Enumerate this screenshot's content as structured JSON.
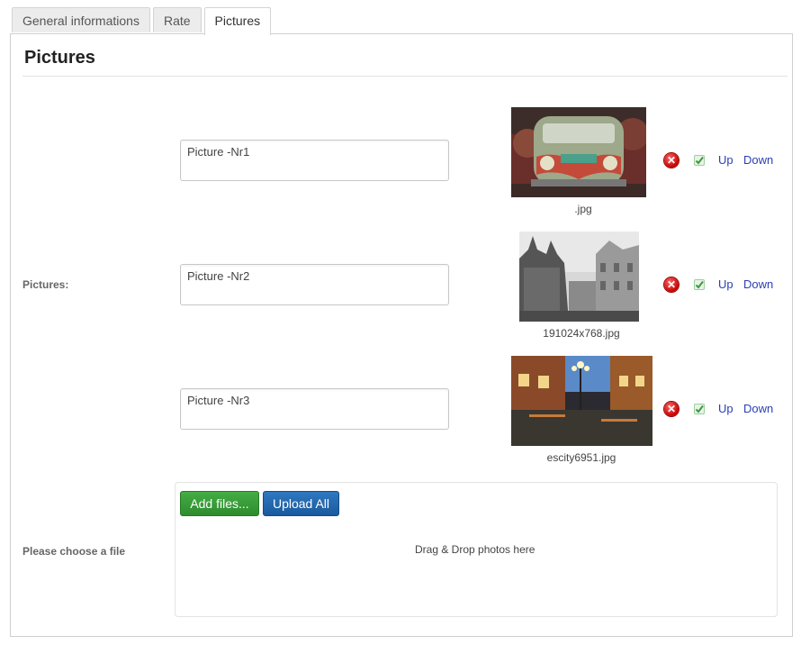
{
  "tabs": [
    {
      "label": "General informations"
    },
    {
      "label": "Rate"
    },
    {
      "label": "Pictures"
    }
  ],
  "section_title": "Pictures",
  "pictures_label": "Pictures:",
  "pictures": [
    {
      "caption": "Picture -Nr1",
      "filename": ".jpg",
      "delete_icon": "delete-icon",
      "accept_icon": "check-icon",
      "up_label": "Up",
      "down_label": "Down"
    },
    {
      "caption": "Picture -Nr2",
      "filename": "191024x768.jpg",
      "delete_icon": "delete-icon",
      "accept_icon": "check-icon",
      "up_label": "Up",
      "down_label": "Down"
    },
    {
      "caption": "Picture -Nr3",
      "filename": "escity6951.jpg",
      "delete_icon": "delete-icon",
      "accept_icon": "check-icon",
      "up_label": "Up",
      "down_label": "Down"
    }
  ],
  "upload": {
    "label": "Please choose a file",
    "add_files_label": "Add files...",
    "upload_all_label": "Upload All",
    "drop_text": "Drag & Drop photos here"
  },
  "colors": {
    "add_button": "#3a9d3a",
    "upload_button": "#1f63a8",
    "link": "#2a3fb3",
    "delete": "#d00000",
    "check": "#4caa4c"
  }
}
